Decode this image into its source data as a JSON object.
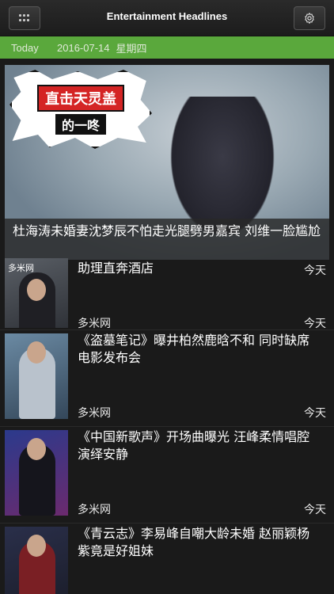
{
  "nav": {
    "title": "Entertainment Headlines",
    "menu_icon": "grid-menu-icon",
    "settings_icon": "gear-icon"
  },
  "date_bar": {
    "today_label": "Today",
    "date": "2016-07-14",
    "weekday": "星期四",
    "color": "#5aa83c"
  },
  "hero": {
    "badge_top": "直击天灵盖",
    "badge_bottom": "的一咚",
    "caption": "杜海涛未婚妻沈梦辰不怕走光腿劈男嘉宾 刘维一脸尴尬"
  },
  "list": {
    "first": {
      "title": "助理直奔酒店",
      "time_top": "今天",
      "source": "多米网",
      "time": "今天",
      "thumb_source": "多米网"
    },
    "items": [
      {
        "title": "《盗墓笔记》曝井柏然鹿晗不和 同时缺席电影发布会",
        "source": "多米网",
        "time": "今天"
      },
      {
        "title": "《中国新歌声》开场曲曝光 汪峰柔情唱腔演绎安静",
        "source": "多米网",
        "time": "今天"
      },
      {
        "title": "《青云志》李易峰自嘲大龄未婚 赵丽颖杨紫竟是好姐妹",
        "source": "",
        "time": ""
      }
    ]
  }
}
